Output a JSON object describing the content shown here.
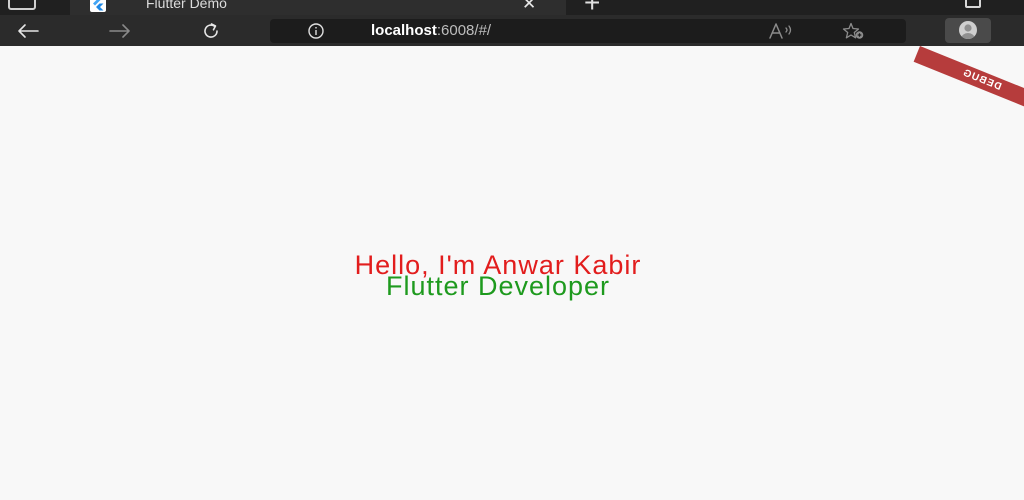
{
  "browser": {
    "tab": {
      "title": "Flutter Demo",
      "close_symbol": "✕",
      "favicon": "flutter-icon"
    },
    "new_tab_symbol": "+",
    "icons": {
      "back": "back-arrow-icon",
      "forward": "forward-arrow-icon",
      "reload": "reload-icon",
      "info": "info-icon",
      "read_aloud": "read-aloud-icon",
      "favorites": "add-favorite-icon",
      "profile": "profile-avatar-icon"
    },
    "address": {
      "host": "localhost",
      "rest": ":6008/#/"
    }
  },
  "page": {
    "debug_banner": "DEBUG",
    "greeting": "Hello, I'm Anwar Kabir",
    "role": "Flutter Developer"
  },
  "colors": {
    "greeting": "#e21d1d",
    "role": "#1e9a1e",
    "debug_banner": "#b63c3c",
    "page_background": "#f8f8f8",
    "toolbar": "#2b2b2b"
  }
}
